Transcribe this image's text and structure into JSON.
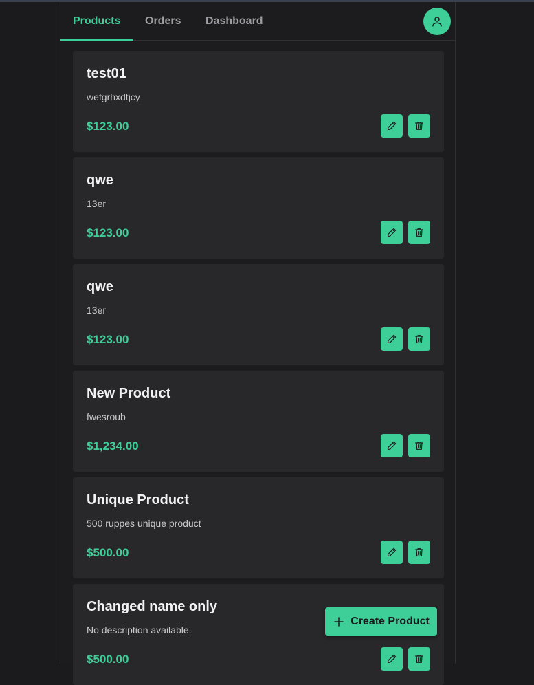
{
  "nav": {
    "tabs": [
      {
        "label": "Products",
        "active": true
      },
      {
        "label": "Orders",
        "active": false
      },
      {
        "label": "Dashboard",
        "active": false
      }
    ],
    "profile_icon": "user-icon"
  },
  "products": [
    {
      "name": "test01",
      "description": "wefgrhxdtjcy",
      "price": "$123.00"
    },
    {
      "name": "qwe",
      "description": "13er",
      "price": "$123.00"
    },
    {
      "name": "qwe",
      "description": "13er",
      "price": "$123.00"
    },
    {
      "name": "New Product",
      "description": "fwesroub",
      "price": "$1,234.00"
    },
    {
      "name": "Unique Product",
      "description": "500 ruppes unique product",
      "price": "$500.00"
    },
    {
      "name": "Changed name only",
      "description": "No description available.",
      "price": "$500.00"
    }
  ],
  "actions": {
    "edit_icon": "pencil-icon",
    "delete_icon": "trash-icon",
    "create_label": "Create Product",
    "create_icon": "plus-icon"
  },
  "colors": {
    "accent": "#3ecf99",
    "background": "#1b1b1d",
    "card": "#28282b"
  }
}
